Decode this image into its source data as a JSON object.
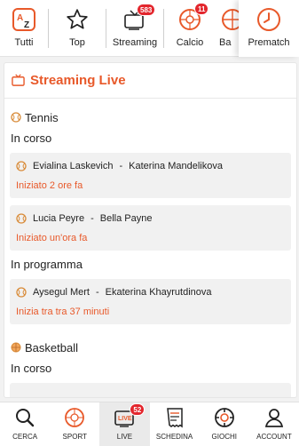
{
  "topnav": {
    "items": [
      {
        "label": "Tutti",
        "icon": "az-icon"
      },
      {
        "label": "Top",
        "icon": "star-icon"
      },
      {
        "label": "Streaming",
        "icon": "tv-icon",
        "badge": "583"
      },
      {
        "label": "Calcio",
        "icon": "soccer-ball-icon",
        "badge": "11"
      },
      {
        "label": "Ba",
        "icon": "basketball-icon"
      }
    ],
    "prematch": {
      "label": "Prematch",
      "icon": "clock-icon"
    }
  },
  "main": {
    "title": "Streaming Live",
    "sports": [
      {
        "name": "Tennis",
        "groups": [
          {
            "state": "In corso",
            "events": [
              {
                "home": "Evialina Laskevich",
                "away": "Katerina Mandelikova",
                "time": "Iniziato 2 ore fa"
              },
              {
                "home": "Lucia Peyre",
                "away": "Bella Payne",
                "time": "Iniziato un'ora fa"
              }
            ]
          },
          {
            "state": "In programma",
            "events": [
              {
                "home": "Aysegul Mert",
                "away": "Ekaterina Khayrutdinova",
                "time": "Inizia tra tra 37 minuti"
              }
            ]
          }
        ]
      },
      {
        "name": "Basketball",
        "groups": [
          {
            "state": "In corso",
            "events": []
          }
        ]
      }
    ],
    "separator": "-"
  },
  "bottomnav": {
    "items": [
      {
        "label": "CERCA",
        "icon": "search-icon"
      },
      {
        "label": "SPORT",
        "icon": "soccer-ball-icon"
      },
      {
        "label": "LIVE",
        "icon": "live-tv-icon",
        "badge": "52",
        "active": true
      },
      {
        "label": "SCHEDINA",
        "icon": "betslip-icon"
      },
      {
        "label": "GIOCHI",
        "icon": "games-icon"
      },
      {
        "label": "ACCOUNT",
        "icon": "user-icon"
      }
    ]
  },
  "colors": {
    "accent": "#e8592a",
    "badge": "#e3262d",
    "card_bg": "#f1f1f1"
  }
}
